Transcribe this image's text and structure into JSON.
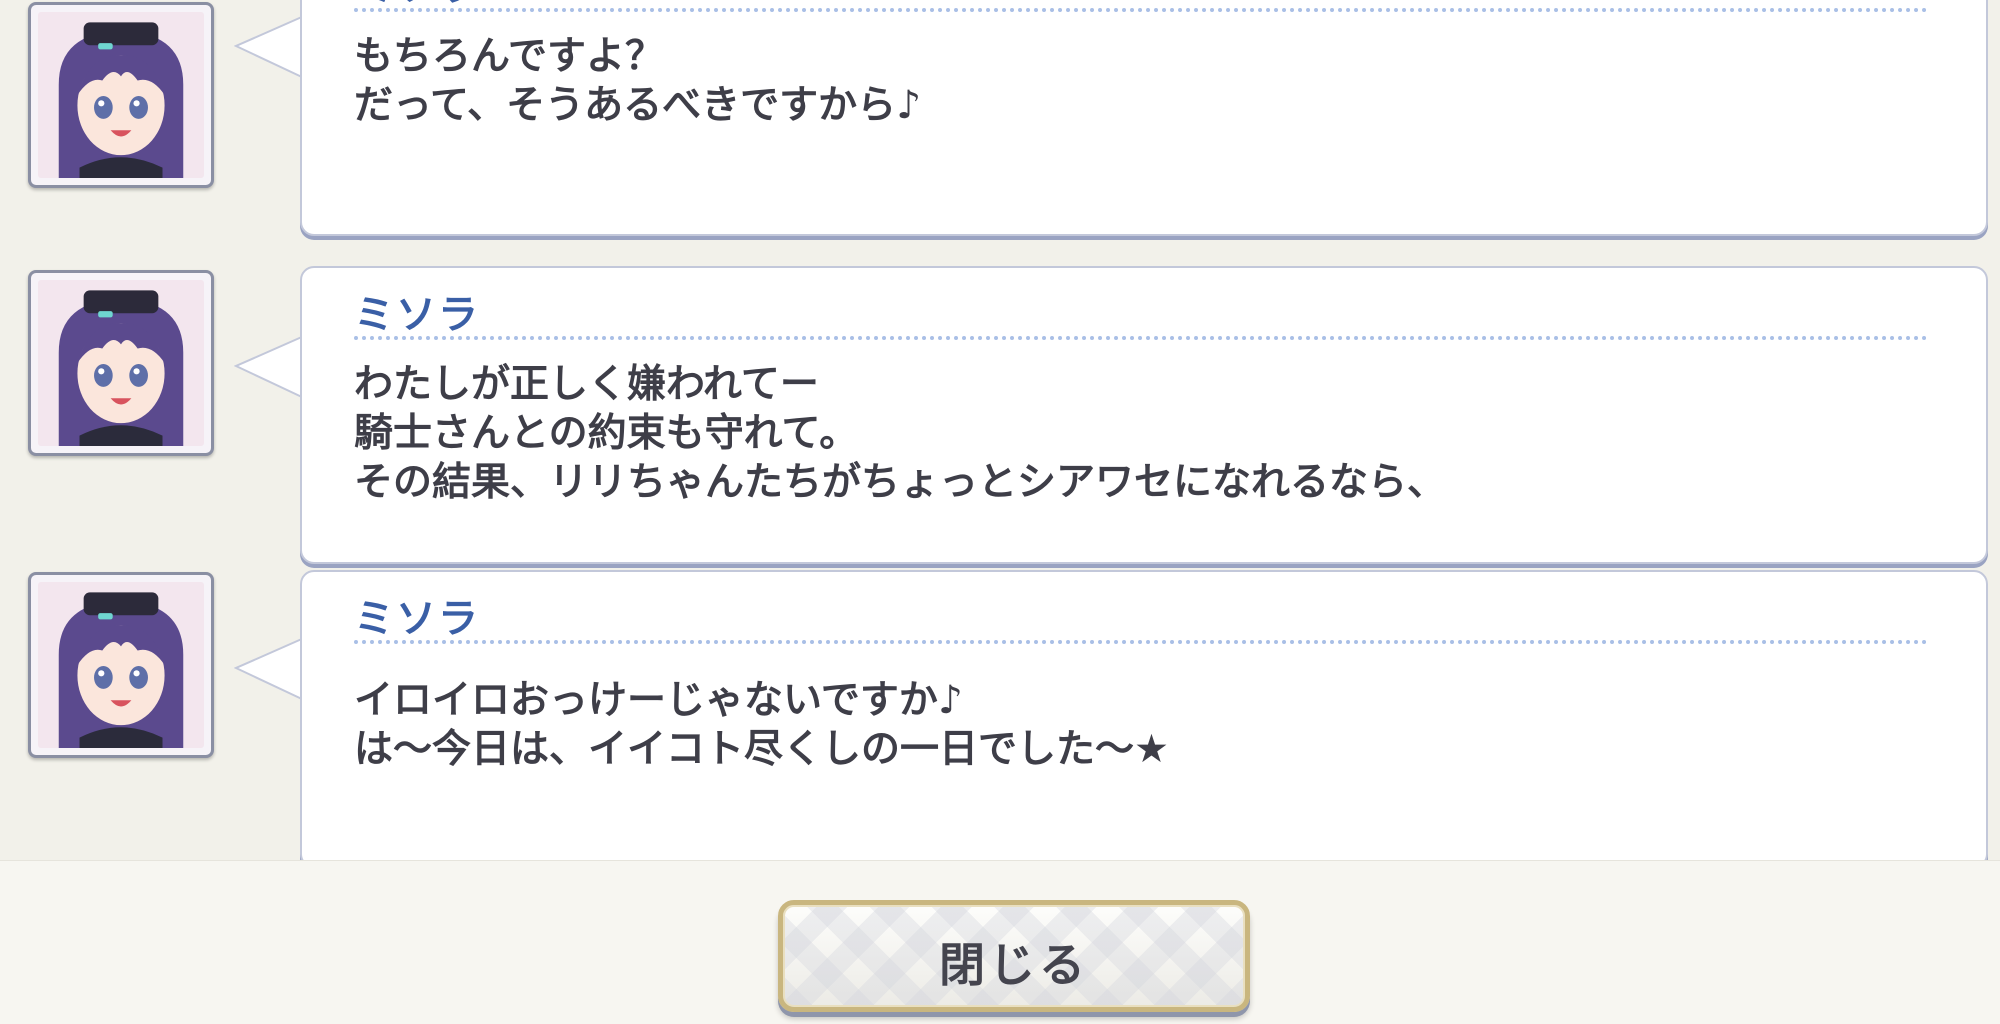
{
  "log": {
    "entries": [
      {
        "speaker": "ミソラ",
        "lines": [
          "もちろんですよ？",
          "だって、そうあるべきですから♪"
        ]
      },
      {
        "speaker": "ミソラ",
        "lines": [
          "わたしが正しく嫌われてー",
          "騎士さんとの約束も守れて。",
          "その結果、リリちゃんたちがちょっとシアワセになれるなら、"
        ]
      },
      {
        "speaker": "ミソラ",
        "lines": [
          "イロイロおっけーじゃないですか♪",
          "は～今日は、イイコト尽くしの一日でした～★"
        ]
      }
    ]
  },
  "footer": {
    "close_label": "閉じる"
  },
  "colors": {
    "speaker": "#3a5fa6",
    "text": "#3e3e48",
    "bubble_border": "#c3c8da",
    "button_border": "#c9b67f"
  }
}
